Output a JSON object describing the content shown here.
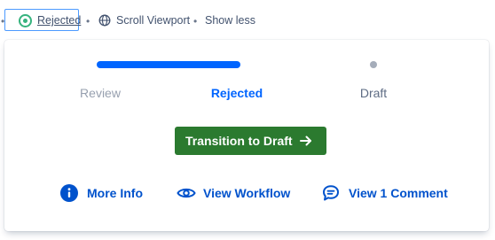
{
  "topbar": {
    "status_label": "Rejected",
    "scroll_label": "Scroll Viewport",
    "show_less_label": "Show less",
    "separator": "•"
  },
  "popup": {
    "steps": [
      {
        "label": "Review",
        "state": "done"
      },
      {
        "label": "Rejected",
        "state": "current"
      },
      {
        "label": "Draft",
        "state": "upcoming"
      }
    ],
    "transition_button": {
      "label": "Transition to Draft"
    },
    "links": {
      "more_info": "More Info",
      "view_workflow": "View Workflow",
      "view_comment": "View 1 Comment"
    }
  },
  "colors": {
    "accent_blue": "#0065ff",
    "link_blue": "#0052cc",
    "step_gray": "#97a0af",
    "step_dark": "#5e6c84",
    "button_green": "#2b7a2f",
    "status_green": "#36b37e",
    "dot_gray": "#a5adba"
  },
  "icons": {
    "status": "status-ring-icon",
    "scroll": "globe-icon",
    "button": "arrow-right-icon",
    "more_info": "info-icon",
    "view_workflow": "eye-icon",
    "view_comment": "comment-icon"
  }
}
